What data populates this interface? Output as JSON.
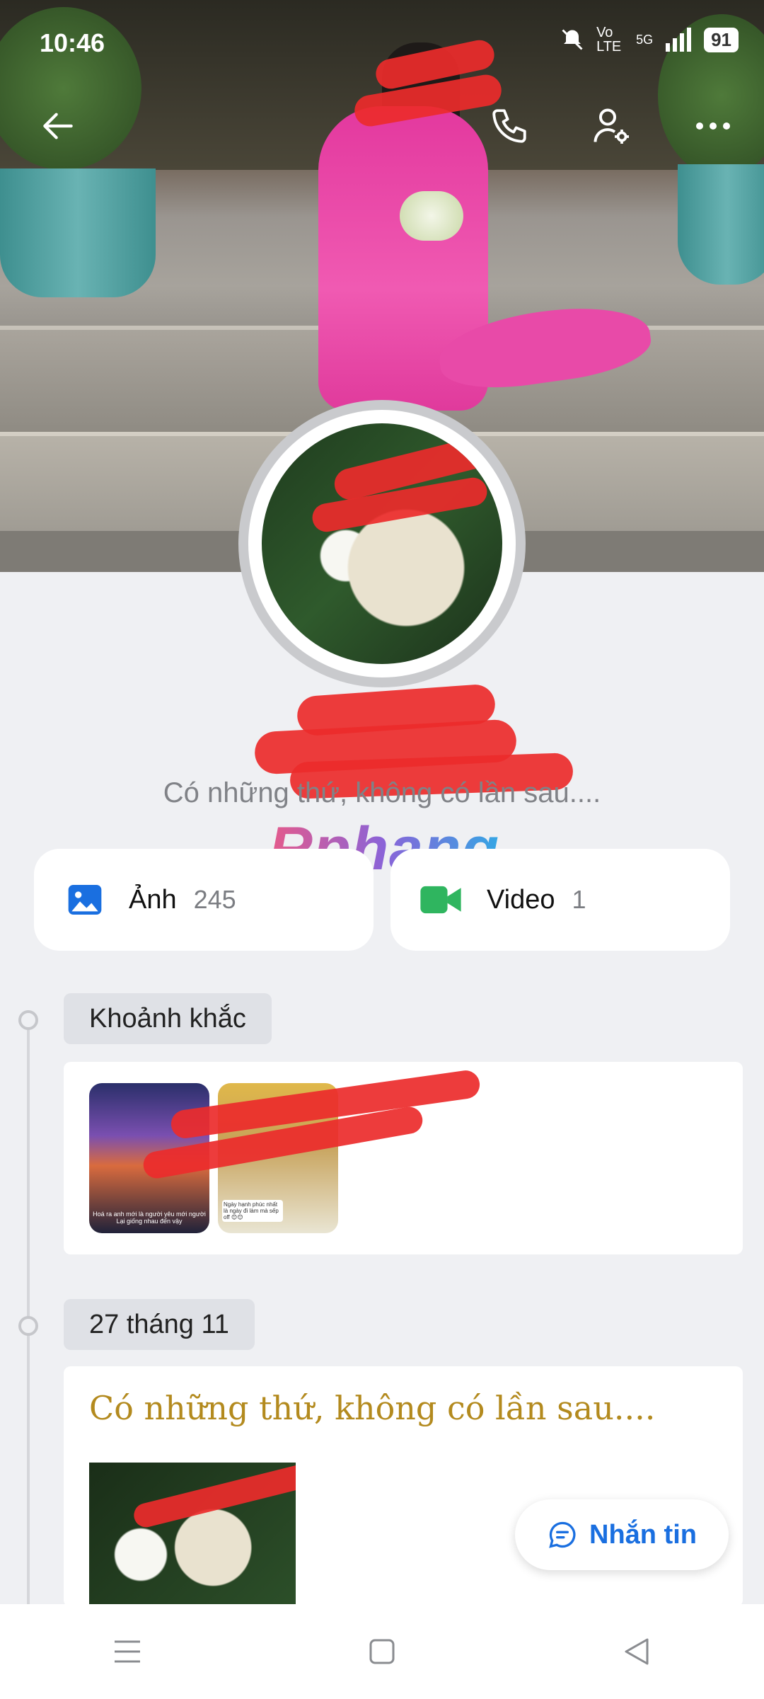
{
  "status_bar": {
    "time": "10:46",
    "network": "5G",
    "volte": "Vo LTE",
    "battery": "91"
  },
  "top_bar": {
    "back_icon": "arrow-left-icon",
    "call_icon": "phone-icon",
    "settings_icon": "user-gear-icon",
    "more_icon": "more-dots-icon"
  },
  "profile": {
    "status": "Có những thứ, không có lần sau...."
  },
  "watermark": "Rphang",
  "media": [
    {
      "label": "Ảnh",
      "count": "245",
      "icon": "image-icon",
      "color": "#1a6fe0"
    },
    {
      "label": "Video",
      "count": "1",
      "icon": "video-camera-icon",
      "color": "#2fb55f"
    }
  ],
  "timeline": {
    "moments_label": "Khoảnh khắc",
    "moment_thumbs": [
      {
        "caption": "Hoá ra anh mới là người yêu mới người\nLại giống nhau đến vậy"
      },
      {
        "caption": "Ngày hạnh phúc nhất là ngày đi làm mà sếp off 😊😊"
      }
    ],
    "date_label": "27 tháng 11",
    "post_title": "Có những thứ, không có lần sau...."
  },
  "message_button": {
    "label": "Nhắn tin",
    "icon": "chat-bubble-icon"
  },
  "nav_bar": {
    "menu_icon": "menu-icon",
    "home_icon": "home-square-icon",
    "back_icon": "back-triangle-icon"
  },
  "colors": {
    "accent": "#1a6fe0",
    "post_title": "#b38a1e",
    "background": "#eff0f3"
  }
}
